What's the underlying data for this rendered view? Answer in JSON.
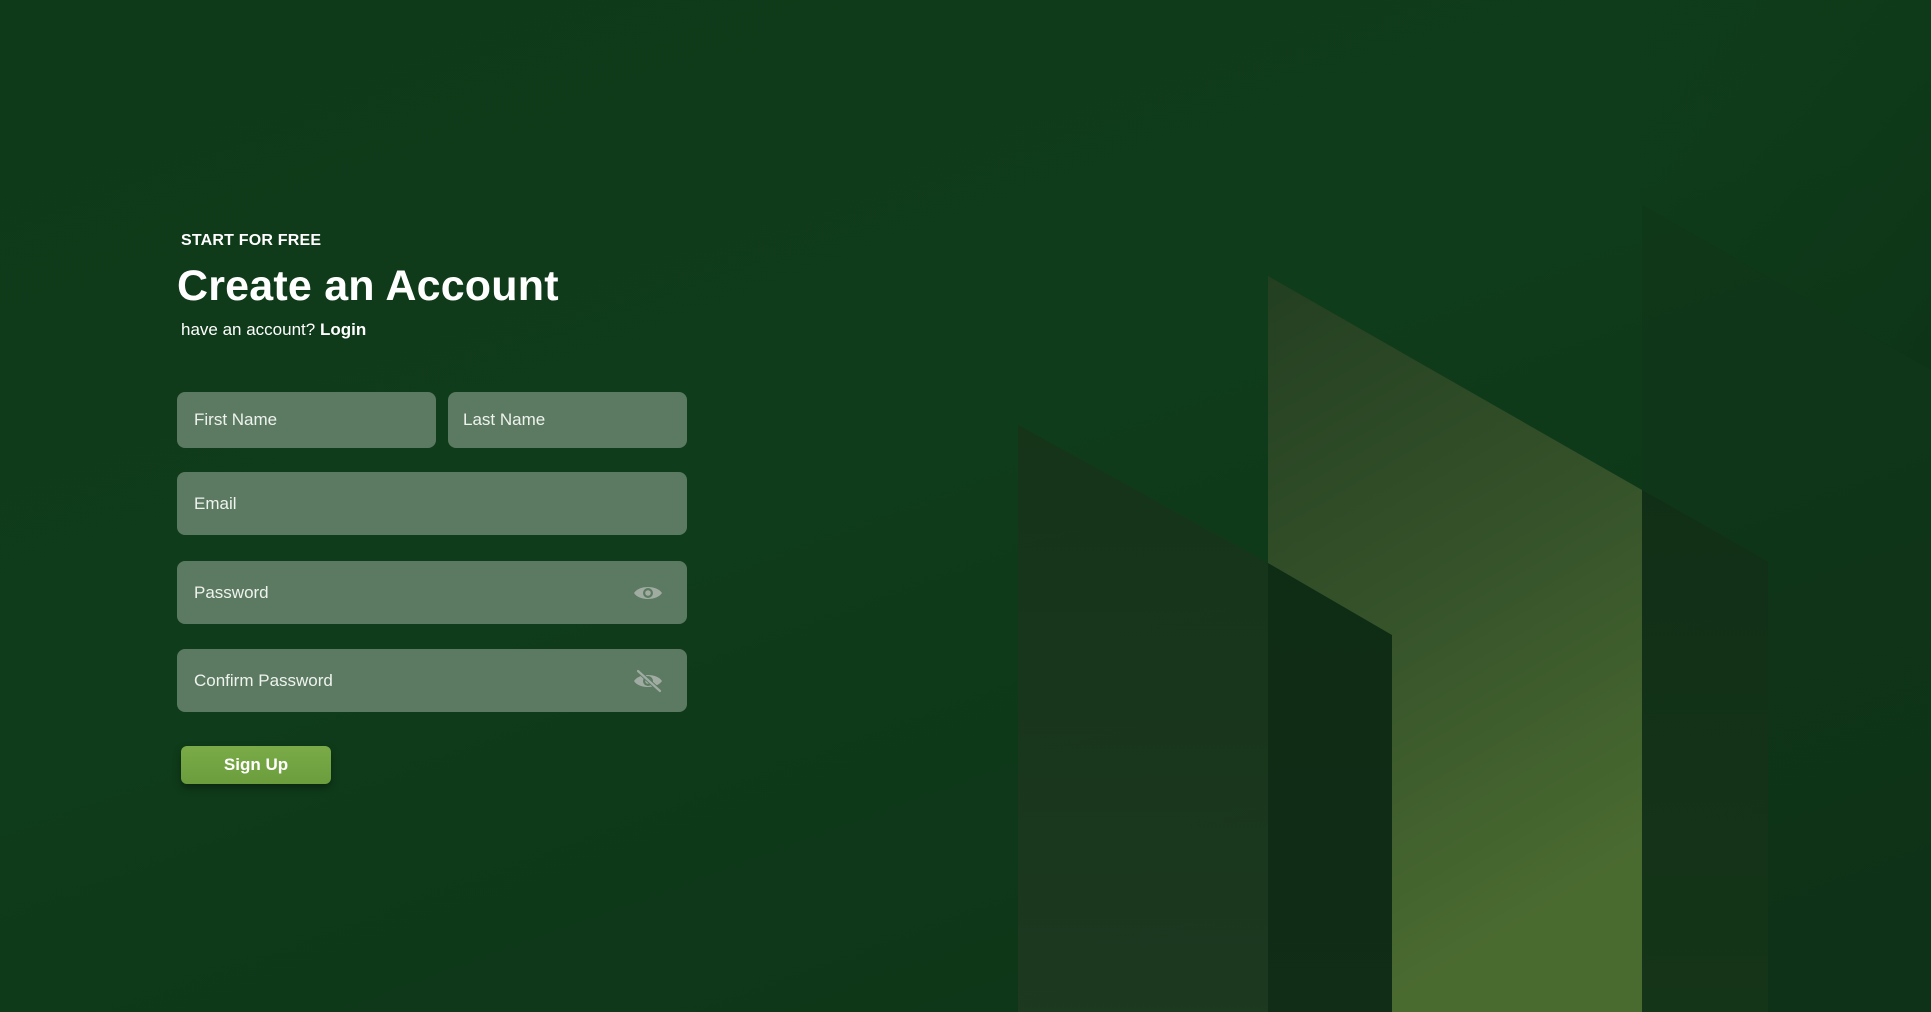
{
  "form": {
    "eyebrow": "START FOR FREE",
    "title": "Create an Account",
    "subline_text": "have an account?",
    "login_label": "Login",
    "first_name": {
      "value": "",
      "placeholder": "First Name"
    },
    "last_name": {
      "value": "",
      "placeholder": "Last Name"
    },
    "email": {
      "value": "",
      "placeholder": "Email"
    },
    "password": {
      "value": "",
      "placeholder": "Password",
      "toggle_icon": "eye-icon"
    },
    "confirm_password": {
      "value": "",
      "placeholder": "Confirm Password",
      "toggle_icon": "eye-slash-icon"
    },
    "submit_label": "Sign Up"
  },
  "colors": {
    "background": "#0f3a19",
    "field": "#5b7a61",
    "button": "#75a643",
    "text": "#ffffff"
  }
}
